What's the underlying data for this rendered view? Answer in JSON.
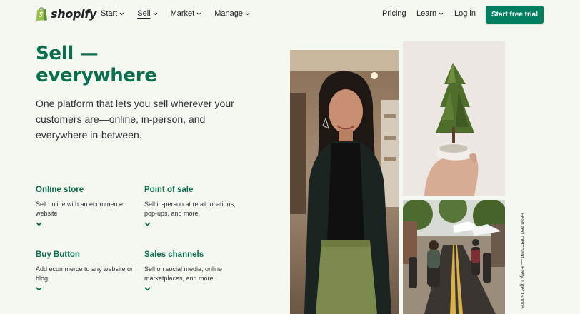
{
  "brand": {
    "name": "shopify",
    "color": "#95bf47"
  },
  "nav": {
    "left": [
      {
        "label": "Start",
        "dropdown": true,
        "active": false
      },
      {
        "label": "Sell",
        "dropdown": true,
        "active": true
      },
      {
        "label": "Market",
        "dropdown": true,
        "active": false
      },
      {
        "label": "Manage",
        "dropdown": true,
        "active": false
      }
    ],
    "pricing": "Pricing",
    "learn": "Learn",
    "login": "Log in",
    "cta": "Start free trial"
  },
  "hero": {
    "title_line1": "Sell —",
    "title_line2": "everywhere",
    "subtitle": "One platform that lets you sell wherever your customers are—online, in-person, and everywhere in-between."
  },
  "features": [
    {
      "title": "Online store",
      "desc": "Sell online with an ecommerce website"
    },
    {
      "title": "Point of sale",
      "desc": "Sell in-person at retail locations, pop-ups, and more"
    },
    {
      "title": "Buy Button",
      "desc": "Add ecommerce to any website or blog"
    },
    {
      "title": "Sales channels",
      "desc": "Sell on social media, online marketplaces, and more"
    }
  ],
  "caption": "Featured merchant — Easy Tiger Goods",
  "colors": {
    "accent": "#0b6e4f",
    "cta": "#008060",
    "background": "#f4f8f0"
  }
}
